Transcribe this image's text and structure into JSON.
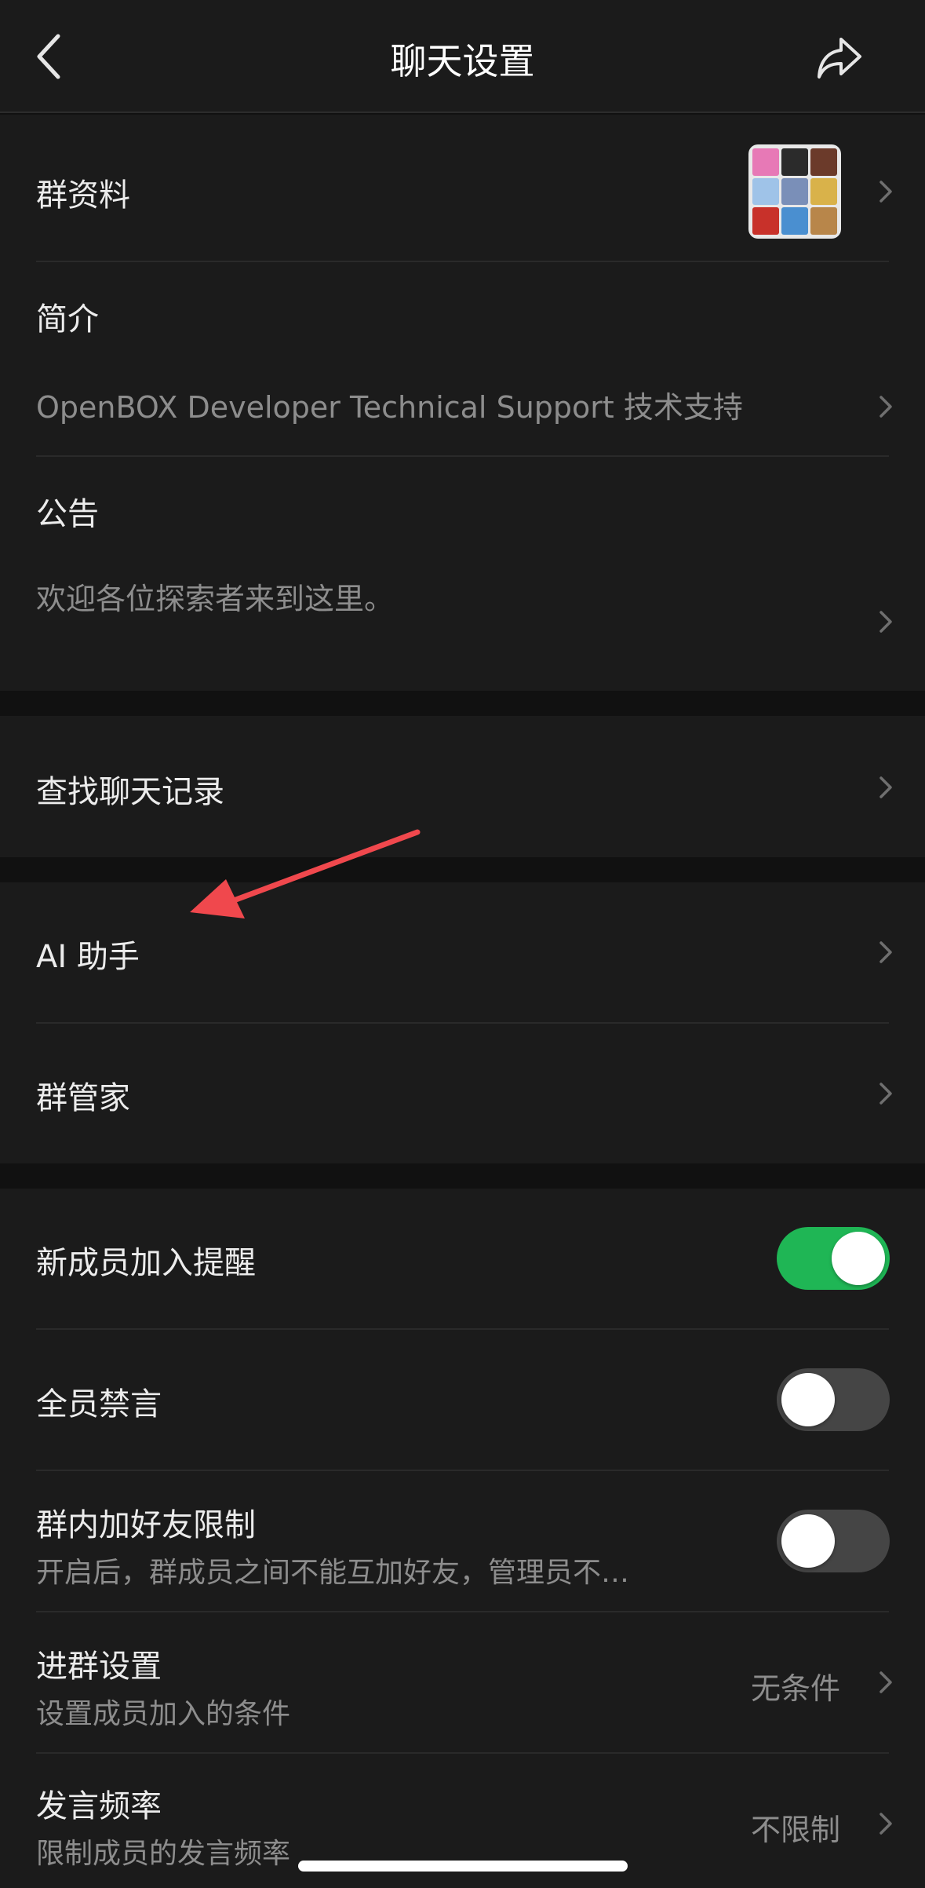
{
  "nav": {
    "title": "聊天设置",
    "back_icon": "chevron-left-icon",
    "share_icon": "share-icon"
  },
  "group_profile": {
    "label": "群资料",
    "avatar_colors": [
      "#e779b6",
      "#2b2b2b",
      "#6b3a2a",
      "#9fc3e8",
      "#7a8fb8",
      "#d9b24a",
      "#c8312a",
      "#4a8fd0",
      "#b8864a"
    ]
  },
  "intro": {
    "label": "简介",
    "text": "OpenBOX Developer Technical Support 技术支持"
  },
  "notice": {
    "label": "公告",
    "text": "欢迎各位探索者来到这里。"
  },
  "search": {
    "label": "查找聊天记录"
  },
  "ai": {
    "label": "AI 助手"
  },
  "manager": {
    "label": "群管家"
  },
  "new_member_alert": {
    "label": "新成员加入提醒",
    "on": true
  },
  "mute_all": {
    "label": "全员禁言",
    "on": false
  },
  "friend_limit": {
    "label": "群内加好友限制",
    "sub": "开启后，群成员之间不能互加好友，管理员不…",
    "on": false
  },
  "join_settings": {
    "label": "进群设置",
    "sub": "设置成员加入的条件",
    "value": "无条件"
  },
  "speak_rate": {
    "label": "发言频率",
    "sub": "限制成员的发言频率",
    "value": "不限制"
  },
  "colors": {
    "accent_green": "#1fb655",
    "annotation_red": "#f0484d"
  }
}
